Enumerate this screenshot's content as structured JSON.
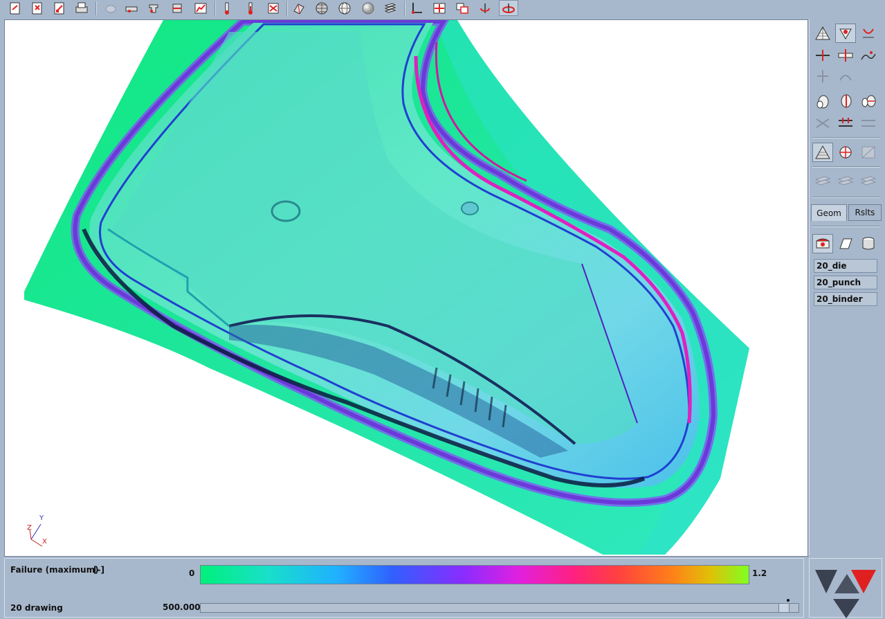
{
  "toolbar": {
    "groups": [
      [
        "open-file-icon",
        "save-file-icon",
        "edit-file-icon",
        "print-icon"
      ],
      [
        "blank-icon",
        "die-tool-icon",
        "punch-tool-icon",
        "binder-tool-icon",
        "curve-plot-icon"
      ],
      [
        "thermometer-icon",
        "thermometer-alt-icon",
        "temperature-map-icon"
      ],
      [
        "shaded-view-icon",
        "wireframe-sphere-icon",
        "mesh-sphere-icon",
        "smooth-sphere-icon",
        "layers-icon"
      ],
      [
        "axis-icon",
        "center-view-icon",
        "fit-view-icon",
        "rotate-view-icon",
        "pan-view-icon"
      ]
    ]
  },
  "right_panel": {
    "tabs": [
      "Geom",
      "Rslts"
    ],
    "active_tab": "Geom",
    "tool_items": [
      "20_die",
      "20_punch",
      "20_binder"
    ]
  },
  "bottom": {
    "result_title": "Failure (maximum)",
    "result_unit": "[-]",
    "scale_min": "0",
    "scale_max": "1.2",
    "step_label": "20 drawing",
    "step_value": "500.000"
  },
  "axes": {
    "y": "Y",
    "z": "Z",
    "x": "X"
  },
  "colors": {
    "panel_bg": "#a8b8cc",
    "accent_red": "#e02020",
    "nav_dark": "#3a4150"
  }
}
